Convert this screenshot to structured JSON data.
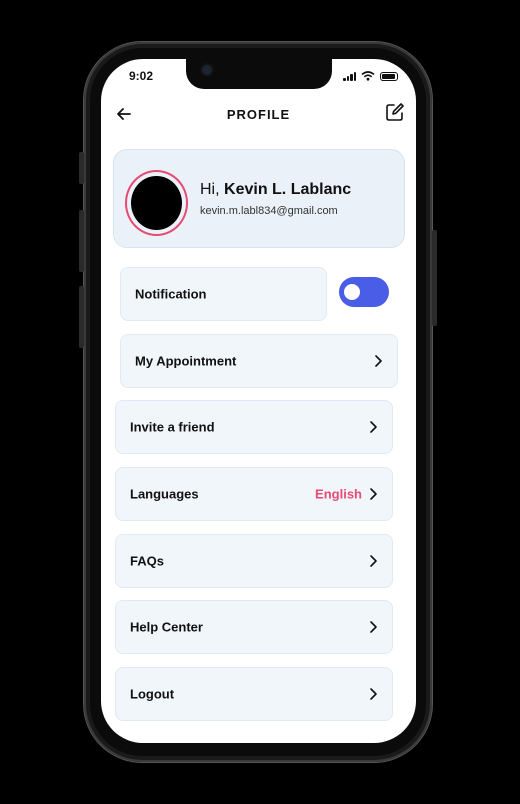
{
  "status_bar": {
    "time": "9:02"
  },
  "header": {
    "title": "PROFILE",
    "back_icon": "arrow-left-icon",
    "edit_icon": "edit-icon"
  },
  "profile": {
    "greeting_prefix": "Hi,",
    "name": "Kevin L. Lablanc",
    "email": "kevin.m.labl834@gmail.com"
  },
  "notification": {
    "label": "Notification",
    "enabled": true
  },
  "menu": {
    "appointment": "My Appointment",
    "invite": "Invite a friend",
    "languages": "Languages",
    "language_value": "English",
    "faqs": "FAQs",
    "help": "Help Center",
    "logout": "Logout"
  },
  "colors": {
    "accent": "#4a5de6",
    "highlight": "#e84a72",
    "card_bg": "#eaf1f8",
    "row_bg": "#f1f6fb"
  }
}
